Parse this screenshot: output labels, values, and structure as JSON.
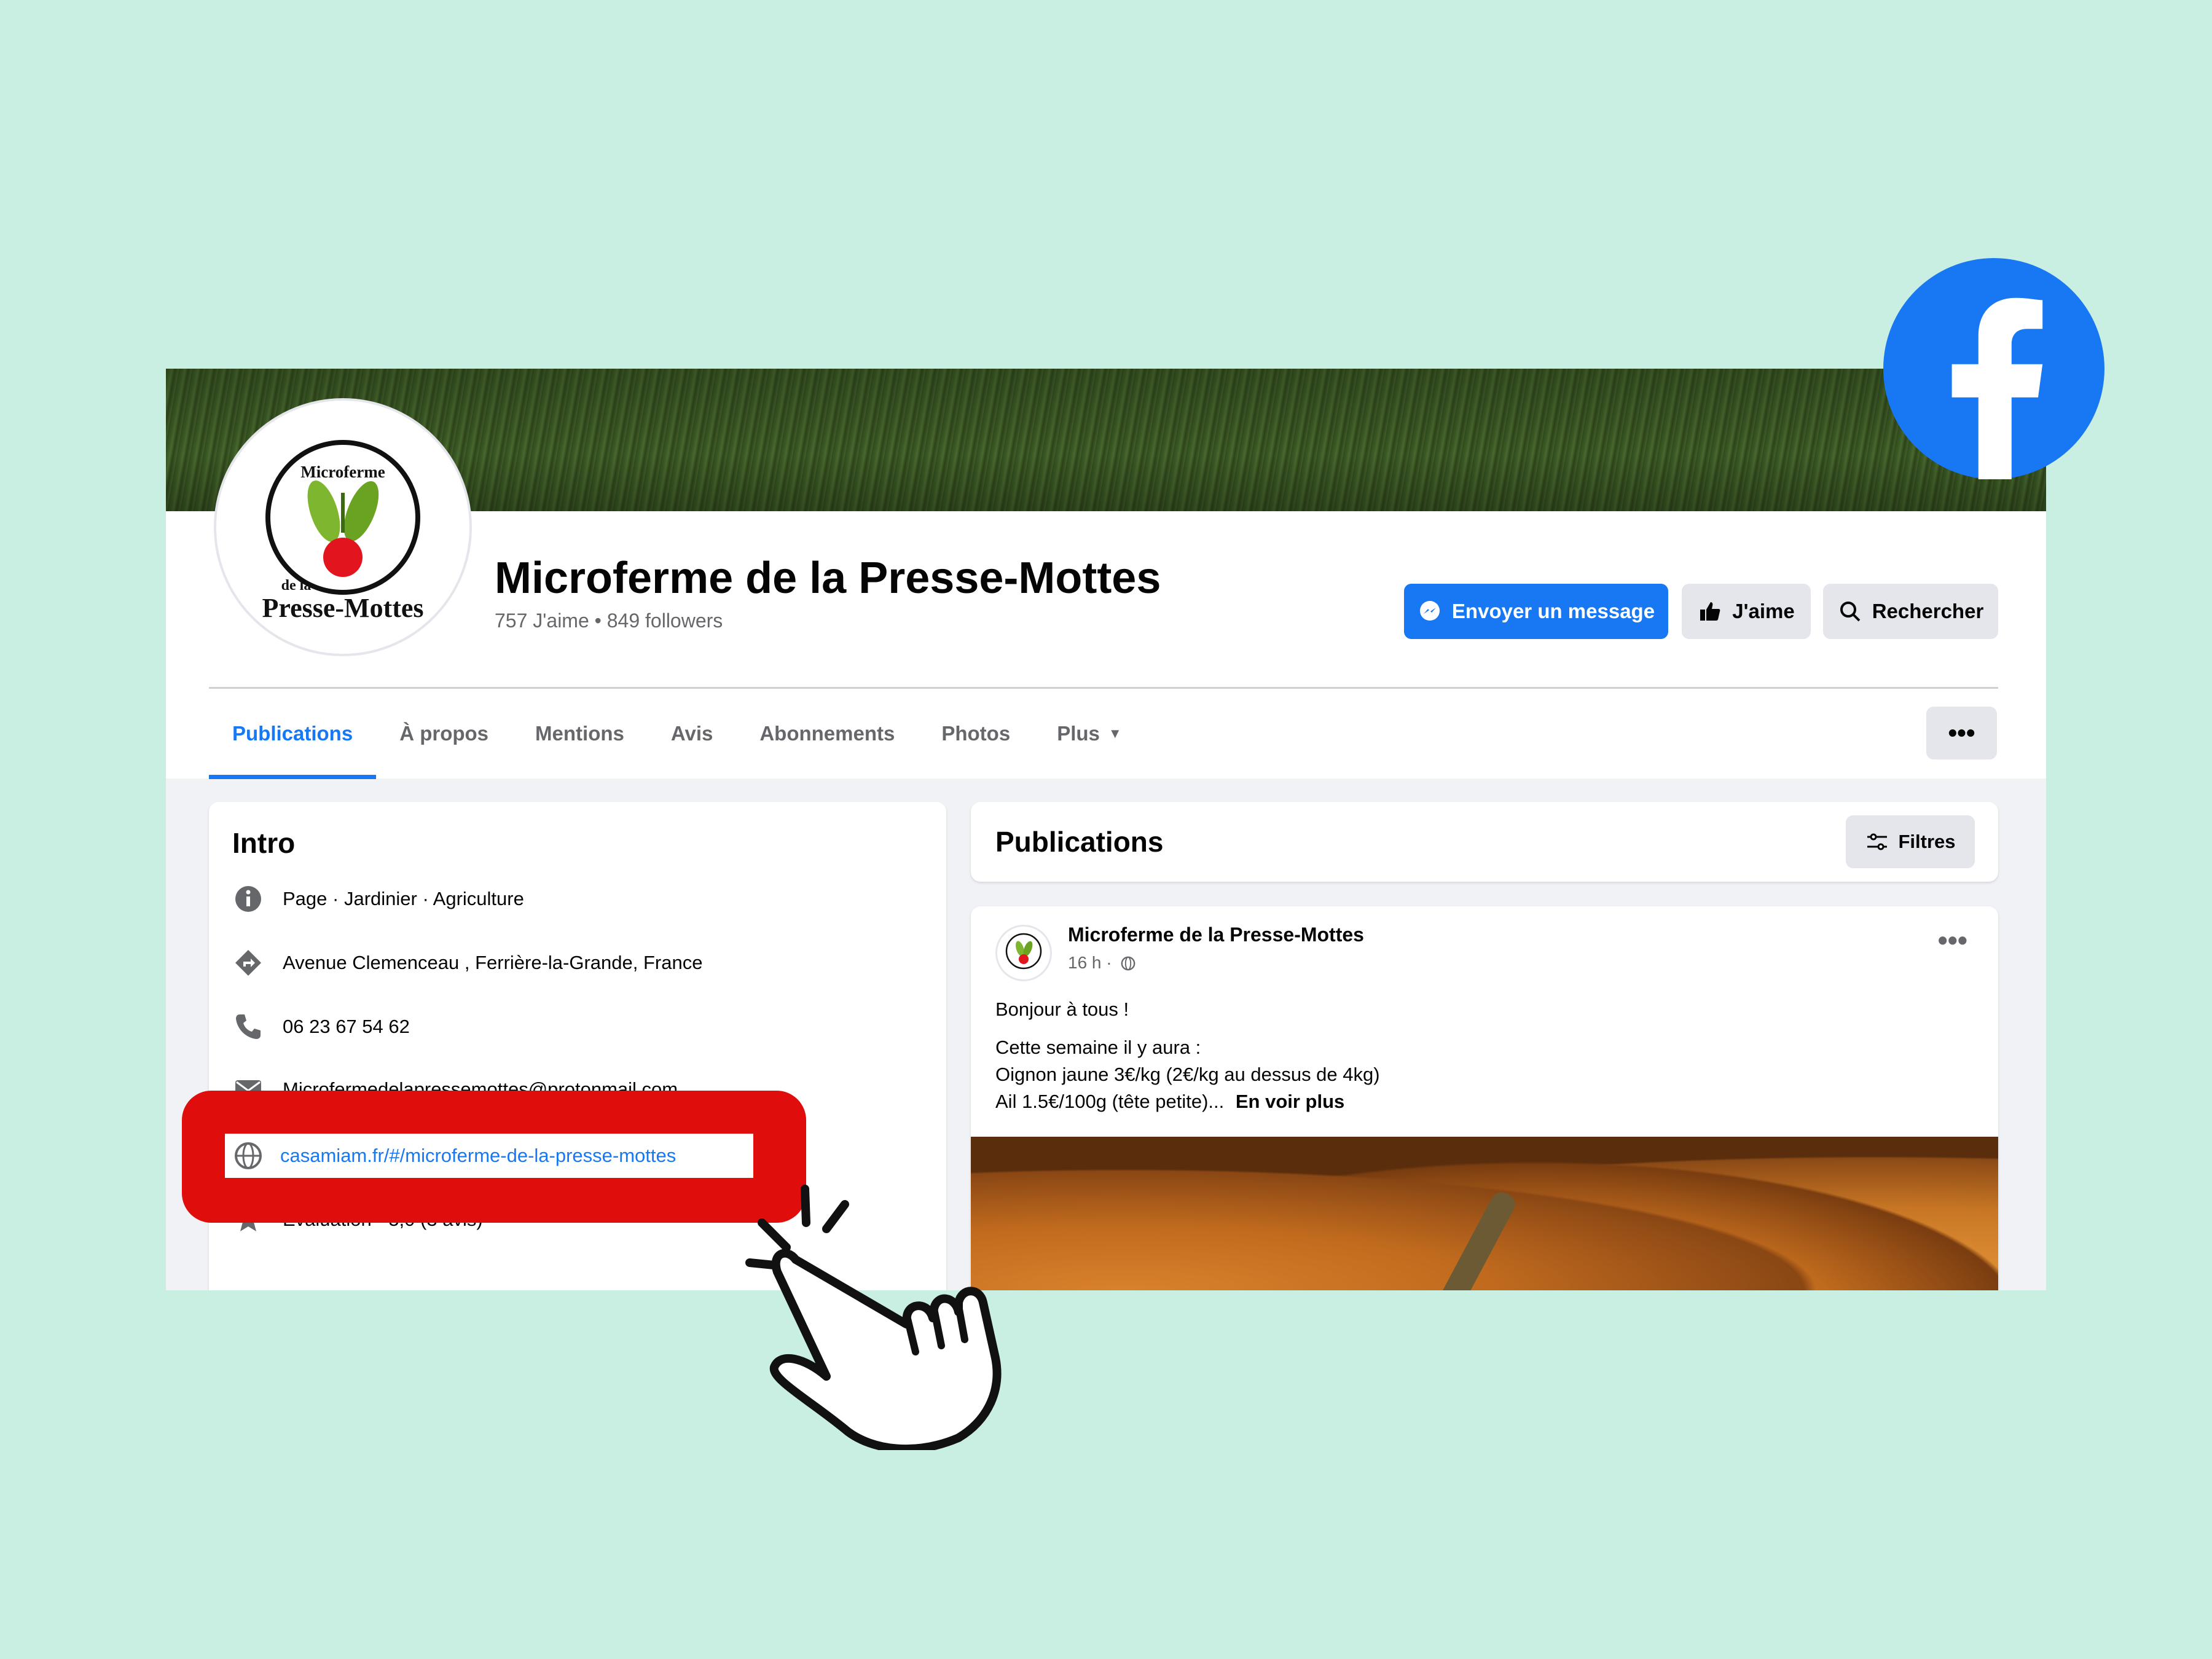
{
  "page": {
    "name": "Microferme de la Presse-Mottes",
    "stats": "757 J'aime • 849 followers",
    "avatar_text": {
      "top": "Microferme",
      "small": "de la",
      "bottom": "Presse-Mottes"
    }
  },
  "actions": {
    "message": "Envoyer un message",
    "like": "J'aime",
    "search": "Rechercher",
    "more": "•••"
  },
  "tabs": [
    "Publications",
    "À propos",
    "Mentions",
    "Avis",
    "Abonnements",
    "Photos",
    "Plus"
  ],
  "intro": {
    "title": "Intro",
    "category": "Page · Jardinier · Agriculture",
    "address": "Avenue Clemenceau , Ferrière-la-Grande, France",
    "phone": "06 23 67 54 62",
    "email": "Microfermedelapressemottes@protonmail.com",
    "website": "casamiam.fr/#/microferme-de-la-presse-mottes",
    "rating": "Évaluation · 5,0 (3 avis)"
  },
  "publications": {
    "title": "Publications",
    "filter": "Filtres"
  },
  "post": {
    "author": "Microferme de la Presse-Mottes",
    "time": "16 h ·",
    "dots": "•••",
    "line1": "Bonjour à tous !",
    "line2": "Cette semaine il y aura :",
    "line3": "Oignon jaune 3€/kg (2€/kg au dessus de 4kg)",
    "line4": "Ail 1.5€/100g (tête petite)...",
    "see_more": "En voir plus"
  },
  "colors": {
    "background": "#c9eee2",
    "facebook_blue": "#1877f2",
    "highlight_red": "#e00d0d"
  },
  "icons": [
    "facebook-logo-icon",
    "pointer-hand-icon",
    "messenger-icon",
    "thumbs-up-icon",
    "search-icon",
    "info-icon",
    "directions-icon",
    "phone-icon",
    "email-icon",
    "globe-icon",
    "star-icon",
    "filter-icon",
    "globe-small-icon"
  ]
}
